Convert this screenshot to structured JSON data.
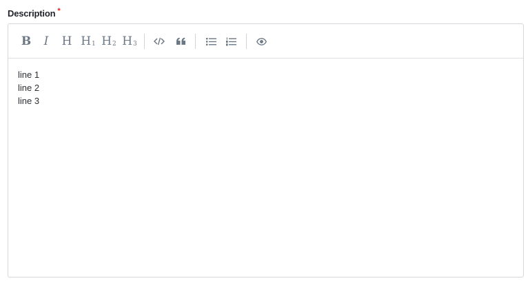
{
  "field": {
    "label": "Description",
    "required_marker": "*"
  },
  "toolbar": {
    "bold": "B",
    "italic": "I",
    "heading": "H",
    "heading1": {
      "main": "H",
      "sub": "1"
    },
    "heading2": {
      "main": "H",
      "sub": "2"
    },
    "heading3": {
      "main": "H",
      "sub": "3"
    },
    "icons": [
      "code-icon",
      "quote-icon",
      "unordered-list-icon",
      "ordered-list-icon",
      "preview-eye-icon"
    ]
  },
  "content": {
    "lines": [
      "line 1",
      "line 2",
      "line 3"
    ]
  },
  "colors": {
    "toolbar_icon": "#6b7785",
    "required": "#e02424",
    "border": "#d3d7dc"
  }
}
